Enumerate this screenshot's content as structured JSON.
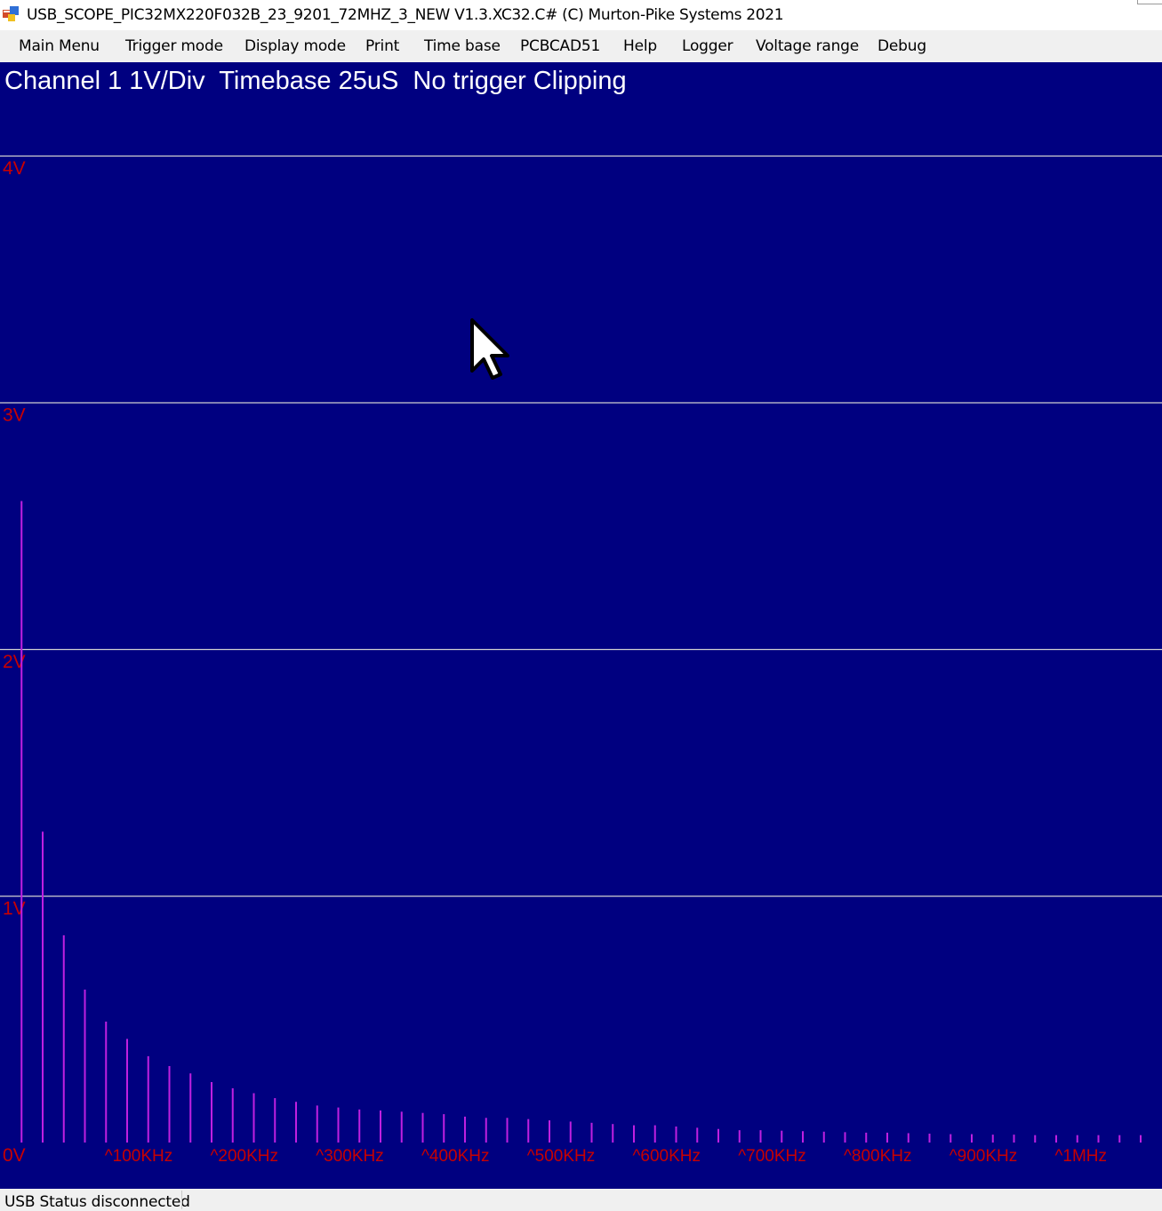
{
  "window": {
    "title": "USB_SCOPE_PIC32MX220F032B_23_9201_72MHZ_3_NEW V1.3.XC32.C# (C) Murton-Pike Systems 2021",
    "icon": "app-window-icon"
  },
  "menu": [
    {
      "label": "Main Menu"
    },
    {
      "label": "Trigger mode"
    },
    {
      "label": "Display mode"
    },
    {
      "label": "Print"
    },
    {
      "label": "Time base"
    },
    {
      "label": "PCBCAD51"
    },
    {
      "label": "Help"
    },
    {
      "label": "Logger"
    },
    {
      "label": "Voltage range"
    },
    {
      "label": "Debug"
    }
  ],
  "scope": {
    "header": "Channel 1 1V/Div  Timebase 25uS  No trigger Clipping",
    "colors": {
      "background": "#000080",
      "gridline": "#d0d0d0",
      "label": "#c80000",
      "trace": "#c020e0",
      "header_text": "#ffffff"
    }
  },
  "status": {
    "text": "USB Status disconnected"
  },
  "chart_data": {
    "type": "bar",
    "y_tick_labels": [
      "4V",
      "3V",
      "2V",
      "1V",
      "0V"
    ],
    "y_ticks": [
      4,
      3,
      2,
      1,
      0
    ],
    "ylim": [
      0,
      4
    ],
    "x_tick_labels": [
      "^100KHz",
      "^200KHz",
      "^300KHz",
      "^400KHz",
      "^500KHz",
      "^600KHz",
      "^700KHz",
      "^800KHz",
      "^900KHz",
      "^1MHz"
    ],
    "x_ticks_khz": [
      100,
      200,
      300,
      400,
      500,
      600,
      700,
      800,
      900,
      1000
    ],
    "xlim_khz": [
      0,
      1100
    ],
    "bin_width_khz": 20,
    "values": [
      2.6,
      1.26,
      0.84,
      0.62,
      0.49,
      0.42,
      0.35,
      0.31,
      0.28,
      0.245,
      0.22,
      0.2,
      0.18,
      0.165,
      0.15,
      0.142,
      0.134,
      0.13,
      0.125,
      0.12,
      0.115,
      0.105,
      0.1,
      0.1,
      0.095,
      0.09,
      0.085,
      0.08,
      0.075,
      0.07,
      0.07,
      0.065,
      0.06,
      0.055,
      0.05,
      0.05,
      0.048,
      0.046,
      0.044,
      0.042,
      0.04,
      0.04,
      0.038,
      0.036,
      0.034,
      0.034,
      0.032,
      0.032,
      0.03,
      0.03,
      0.03,
      0.03,
      0.03,
      0.03
    ],
    "grid": true
  }
}
